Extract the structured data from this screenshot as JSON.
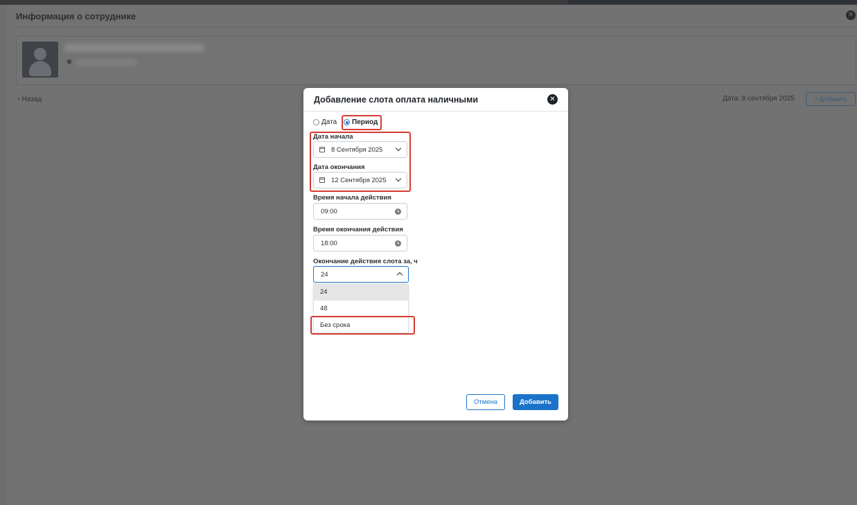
{
  "background": {
    "panel_title": "Информация о сотруднике",
    "back_label": "Назад",
    "date_label": "Дата: 8 сентября 2025",
    "add_button_label": "+ Добавить"
  },
  "modal": {
    "title": "Добавление слота оплата наличными",
    "mode": {
      "option_date": "Дата",
      "option_period": "Период",
      "selected": "Период"
    },
    "start_date": {
      "label": "Дата начала",
      "value": "8 Сентября 2025"
    },
    "end_date": {
      "label": "Дата окончания",
      "value": "12 Сентября 2025"
    },
    "start_time": {
      "label": "Время начала действия",
      "value": "09:00"
    },
    "end_time": {
      "label": "Время окончания действия",
      "value": "18:00"
    },
    "slot_end": {
      "label": "Окончание действия слота за, ч",
      "value": "24",
      "options": [
        "24",
        "48",
        "Без срока"
      ]
    },
    "cancel_label": "Отмена",
    "submit_label": "Добавить"
  },
  "colors": {
    "accent": "#1a73c9",
    "highlight": "#d63b32",
    "overlay": "#727272"
  }
}
